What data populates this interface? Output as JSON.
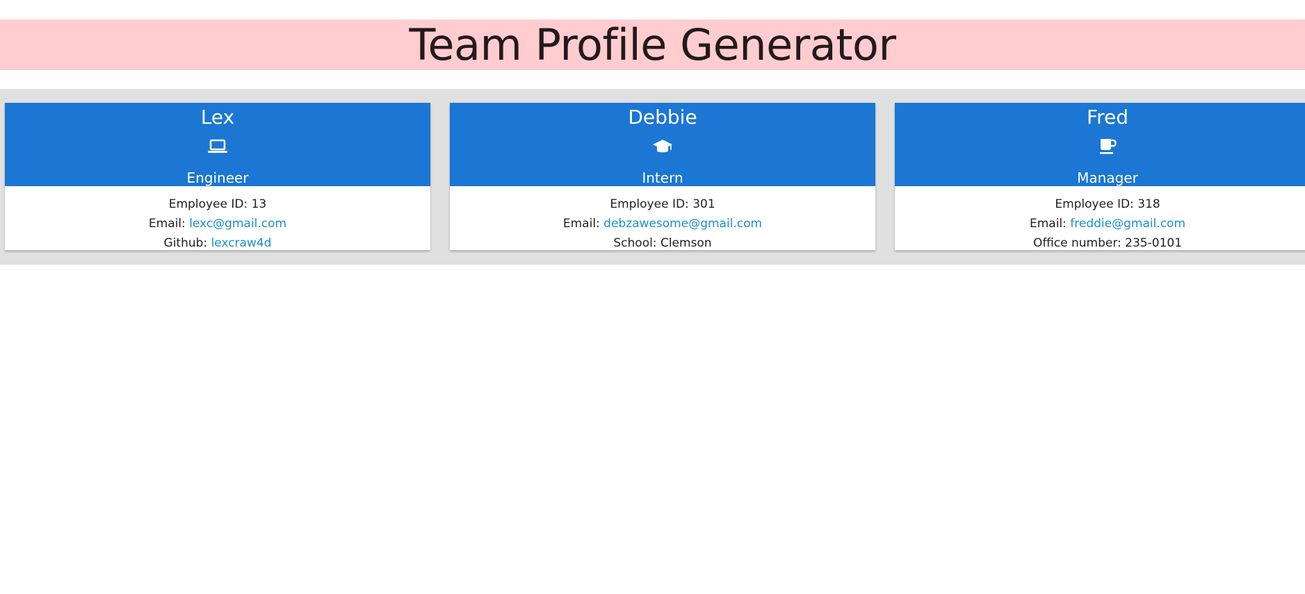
{
  "header": {
    "title": "Team Profile Generator"
  },
  "team": [
    {
      "name": "Lex",
      "icon": "laptop-icon",
      "role": "Engineer",
      "id_label": "Employee ID: ",
      "id": "13",
      "email_label": "Email: ",
      "email": "lexc@gmail.com",
      "extra_label": "Github: ",
      "extra_value": "lexcraw4d"
    },
    {
      "name": "Debbie",
      "icon": "graduation-cap-icon",
      "role": "Intern",
      "id_label": "Employee ID: ",
      "id": "301",
      "email_label": "Email: ",
      "email": "debzawesome@gmail.com",
      "extra_label": "School: ",
      "extra_value": "Clemson"
    },
    {
      "name": "Fred",
      "icon": "coffee-mug-icon",
      "role": "Manager",
      "id_label": "Employee ID: ",
      "id": "318",
      "email_label": "Email: ",
      "email": "freddie@gmail.com",
      "extra_label": "Office number: ",
      "extra_value": "235-0101"
    }
  ],
  "colors": {
    "header_bg": "#ffccd0",
    "card_header_bg": "#1b76d4",
    "link": "#1a8fcf",
    "strip_bg": "#e0e0e0"
  }
}
